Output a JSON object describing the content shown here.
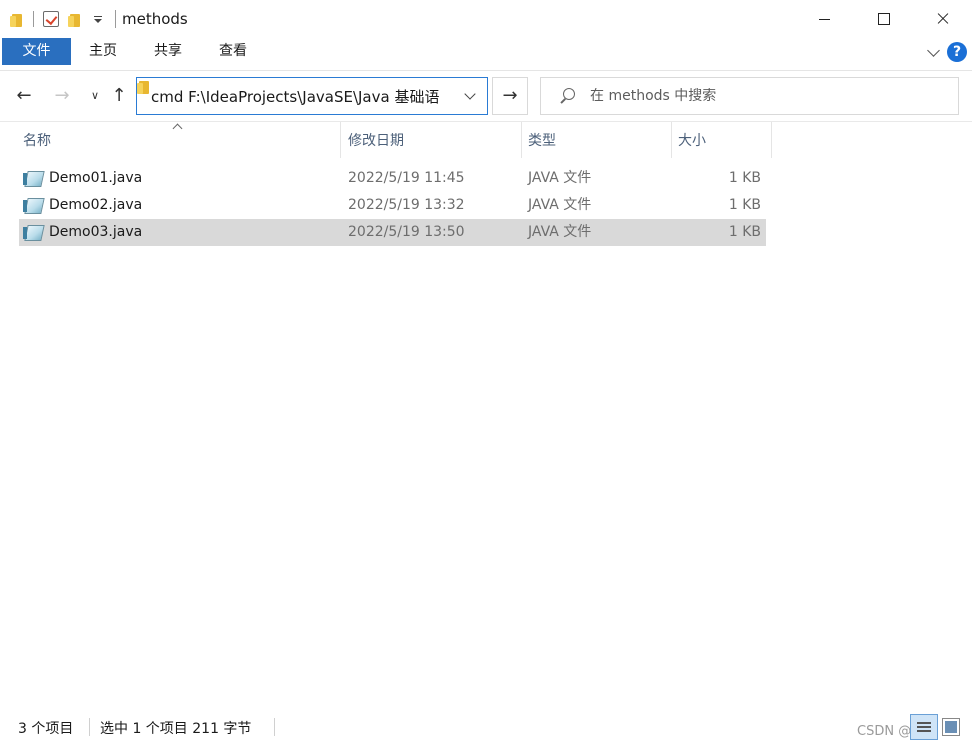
{
  "window": {
    "title": "methods"
  },
  "ribbon": {
    "tabs": [
      {
        "label": "文件"
      },
      {
        "label": "主页"
      },
      {
        "label": "共享"
      },
      {
        "label": "查看"
      }
    ],
    "help": "?"
  },
  "nav": {
    "back": "←",
    "forward": "→",
    "recent": "∨",
    "up": "↑",
    "address": "cmd F:\\IdeaProjects\\JavaSE\\Java 基础语",
    "go": "→"
  },
  "search": {
    "placeholder": "在 methods 中搜索"
  },
  "columns": {
    "name": "名称",
    "date": "修改日期",
    "type": "类型",
    "size": "大小"
  },
  "files": [
    {
      "name": "Demo01.java",
      "date": "2022/5/19 11:45",
      "type": "JAVA 文件",
      "size": "1 KB",
      "selected": false
    },
    {
      "name": "Demo02.java",
      "date": "2022/5/19 13:32",
      "type": "JAVA 文件",
      "size": "1 KB",
      "selected": false
    },
    {
      "name": "Demo03.java",
      "date": "2022/5/19 13:50",
      "type": "JAVA 文件",
      "size": "1 KB",
      "selected": true
    }
  ],
  "status": {
    "count": "3 个项目",
    "selected": "选中 1 个项目  211 字节"
  },
  "watermark": "CSDN @悲欢",
  "colors": {
    "file_tab": "#2a6fbf",
    "address_border": "#2a7bd4",
    "selected_row": "#d9d9d9",
    "help": "#1a6fd6"
  }
}
